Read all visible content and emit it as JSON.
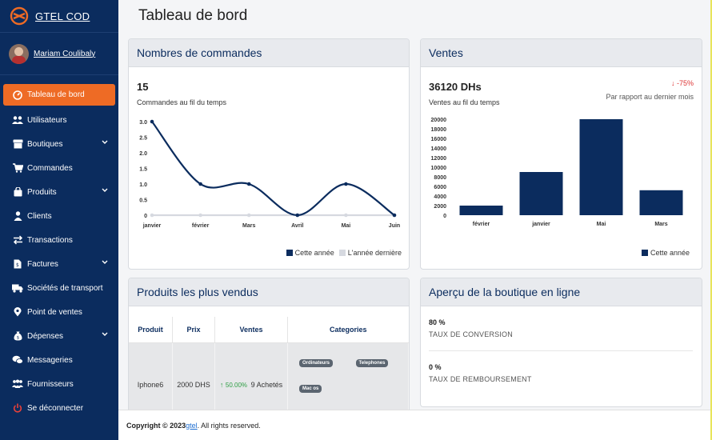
{
  "brand": {
    "name": "GTEL COD"
  },
  "user": {
    "name": "Mariam Coulibaly"
  },
  "menu": [
    {
      "label": "Tableau de bord"
    },
    {
      "label": "Utilisateurs"
    },
    {
      "label": "Boutiques"
    },
    {
      "label": "Commandes"
    },
    {
      "label": "Produits"
    },
    {
      "label": "Clients"
    },
    {
      "label": "Transactions"
    },
    {
      "label": "Factures"
    },
    {
      "label": "Sociétés de transport"
    },
    {
      "label": "Point de ventes"
    },
    {
      "label": "Dépenses"
    },
    {
      "label": "Messageries"
    },
    {
      "label": "Fournisseurs"
    },
    {
      "label": "Se déconnecter"
    }
  ],
  "page_title": "Tableau de bord",
  "orders_card": {
    "title": "Nombres de commandes",
    "total": "15",
    "subtitle": "Commandes au fil du temps",
    "legend_current": "Cette année",
    "legend_previous": "L'année dernière"
  },
  "sales_card": {
    "title": "Ventes",
    "total": "36120 DHs",
    "subtitle": "Ventes au fil du temps",
    "change": "-75%",
    "change_note": "Par rapport au dernier mois",
    "legend_current": "Cette année"
  },
  "products_card": {
    "title": "Produits les plus vendus",
    "headers": [
      "Produit",
      "Prix",
      "Ventes",
      "Categories"
    ],
    "rows": [
      {
        "product": "Iphone6",
        "price": "2000 DHS",
        "growth": "50.00%",
        "sold": "9 Achetés",
        "categories": [
          "Ordinateurs",
          "Telephones",
          "Mac os"
        ]
      }
    ]
  },
  "shop_card": {
    "title": "Aperçu de la boutique en ligne",
    "kpis": [
      {
        "value": "80 %",
        "label": "TAUX DE CONVERSION"
      },
      {
        "value": "0 %",
        "label": "TAUX DE REMBOURSEMENT"
      }
    ]
  },
  "footer": {
    "prefix": "Copyright © 2023",
    "link": "gtel",
    "suffix": ". All rights reserved."
  },
  "colors": {
    "sidebar": "#0b2c5e",
    "accent": "#ee6b25",
    "series": "#0b2c5e",
    "series_prev": "#d6d9e0"
  },
  "chart_data": [
    {
      "type": "line",
      "x": [
        "janvier",
        "février",
        "Mars",
        "Avril",
        "Mai",
        "Juin"
      ],
      "series": [
        {
          "name": "Cette année",
          "values": [
            3,
            1,
            1,
            0,
            1,
            0
          ]
        },
        {
          "name": "L'année dernière",
          "values": [
            0,
            0,
            0,
            0,
            0,
            0
          ]
        }
      ],
      "yticks": [
        "0",
        "0.5",
        "1.0",
        "1.5",
        "2.0",
        "2.5",
        "3.0"
      ],
      "ylim": [
        0,
        3
      ],
      "grid": false,
      "legend": "bottom-right"
    },
    {
      "type": "bar",
      "categories": [
        "février",
        "janvier",
        "Mai",
        "Mars"
      ],
      "series": [
        {
          "name": "Cette année",
          "values": [
            2000,
            9000,
            20000,
            5200
          ]
        }
      ],
      "yticks": [
        "0",
        "2000",
        "4000",
        "6000",
        "8000",
        "10000",
        "12000",
        "14000",
        "16000",
        "18000",
        "20000"
      ],
      "ylim": [
        0,
        20000
      ],
      "grid": false,
      "legend": "bottom-right"
    }
  ]
}
